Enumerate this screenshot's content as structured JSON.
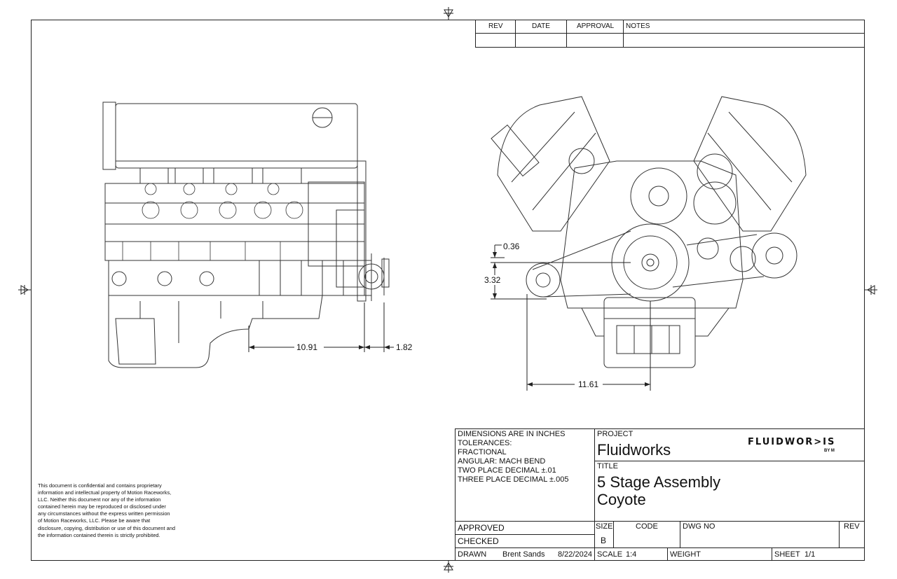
{
  "revision_block": {
    "headers": [
      "REV",
      "DATE",
      "APPROVAL",
      "NOTES"
    ]
  },
  "dimensions": {
    "side_offset": "10.91",
    "side_overhang": "1.82",
    "front_width": "11.61",
    "front_height": "3.32",
    "front_small": "0.36"
  },
  "tolerance_note": {
    "line1": "DIMENSIONS ARE IN INCHES",
    "line2": "TOLERANCES:",
    "line3": "FRACTIONAL",
    "line4": "ANGULAR: MACH BEND",
    "line5": "TWO PLACE DECIMAL ±.01",
    "line6": "THREE PLACE DECIMAL ±.005"
  },
  "project": {
    "label": "PROJECT",
    "value": "Fluidworks"
  },
  "logo": {
    "text": "FLUIDWOR>IS",
    "sub": "BY M"
  },
  "title": {
    "label": "TITLE",
    "line1": "5 Stage Assembly",
    "line2": "Coyote"
  },
  "signoff": {
    "approved": "APPROVED",
    "checked": "CHECKED",
    "drawn": "DRAWN",
    "drawn_by": "Brent Sands",
    "drawn_date": "8/22/2024"
  },
  "sheet_info": {
    "size_label": "SIZE",
    "size_value": "B",
    "code_label": "CODE",
    "dwg_label": "DWG NO",
    "rev_label": "REV",
    "scale_label": "SCALE",
    "scale_value": "1:4",
    "weight_label": "WEIGHT",
    "sheet_label": "SHEET",
    "sheet_value": "1/1"
  },
  "confidentiality": "This document is confidential and contains proprietary information and intellectual property of Motion Raceworks, LLC. Neither this document nor any of the information contained herein may be reproduced or disclosed under any circumstances without the express written permission of Motion Raceworks, LLC. Please be aware that disclosure, copying, distribution or use of this document and the information contained therein is strictly prohibited."
}
